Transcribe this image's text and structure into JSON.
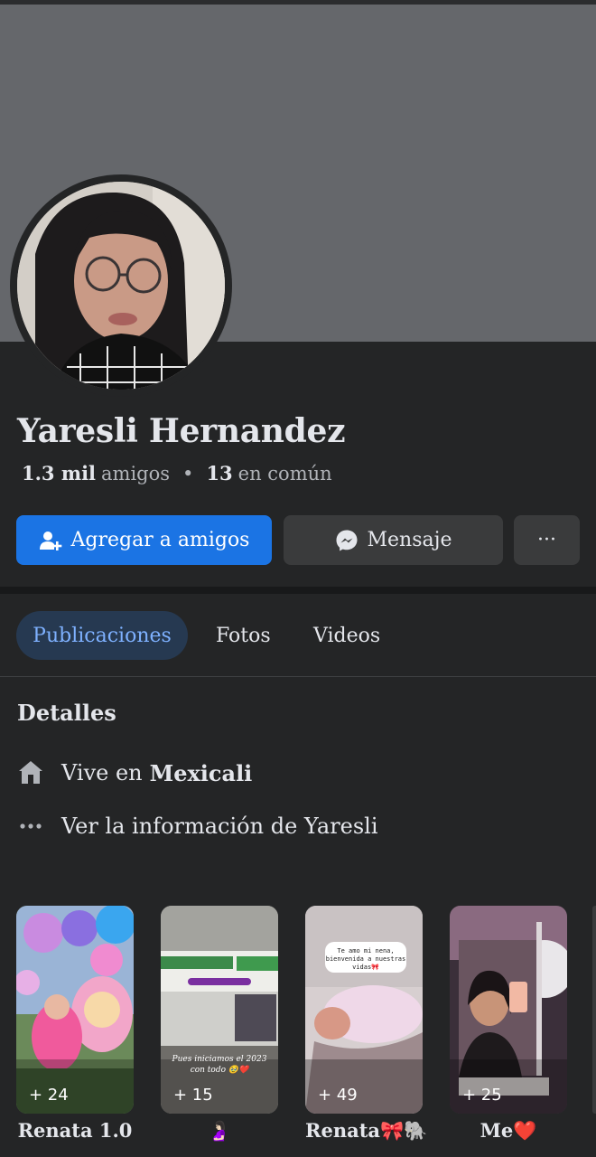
{
  "profile": {
    "name": "Yaresli Hernandez",
    "friends_count": "1.3 mil",
    "friends_label": "amigos",
    "mutual_count": "13",
    "mutual_label": "en común"
  },
  "actions": {
    "add_friend_label": "Agregar a amigos",
    "message_label": "Mensaje",
    "more_label": "···"
  },
  "tabs": [
    {
      "label": "Publicaciones",
      "active": true
    },
    {
      "label": "Fotos",
      "active": false
    },
    {
      "label": "Videos",
      "active": false
    }
  ],
  "details": {
    "title": "Detalles",
    "lives_in_prefix": "Vive en",
    "lives_in_city": "Mexicali",
    "see_info": "Ver la información de Yaresli"
  },
  "highlights": [
    {
      "label": "Renata 1.0",
      "count": "+ 24",
      "caption": ""
    },
    {
      "label": "🤰🏻",
      "count": "+ 15",
      "caption": "Pues iniciamos el 2023 con todo 🥹❤️"
    },
    {
      "label": "Renata🎀🐘",
      "count": "+ 49",
      "caption": "Te amo mi nena, bienvenida a nuestras vidas🎀"
    },
    {
      "label": "Me❤️",
      "count": "+ 25",
      "caption": ""
    }
  ],
  "colors": {
    "background": "#242526",
    "cover": "#65676b",
    "primary_button": "#1b74e4",
    "secondary_button": "#3a3b3c",
    "active_tab_bg": "#263951",
    "active_tab_text": "#7eb1ff"
  },
  "icons": {
    "add_friend": "person-plus-icon",
    "message": "messenger-icon",
    "home": "home-icon",
    "more": "ellipsis-icon"
  }
}
